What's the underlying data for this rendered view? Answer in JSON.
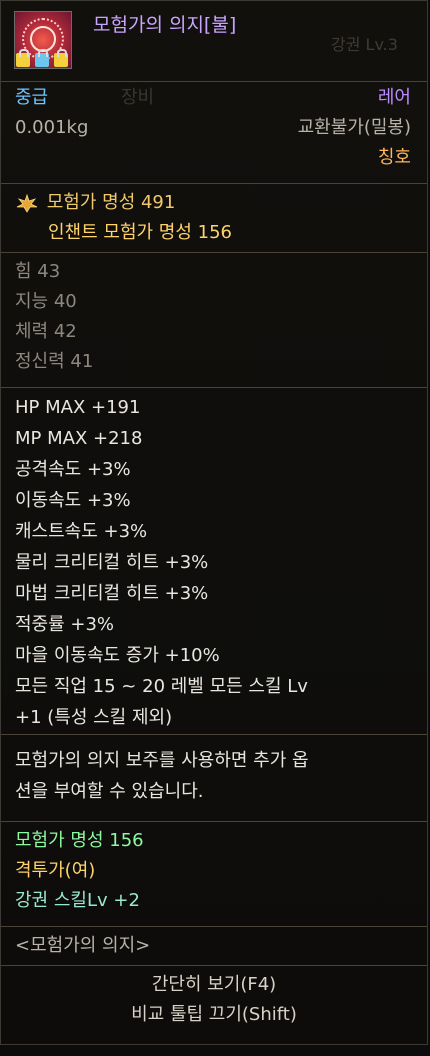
{
  "item": {
    "name": "모험가의 의지[불]",
    "watermark": "강권 Lv.3",
    "icon": "red-orb-emblem-icon",
    "lock_icons": [
      "yellow-lock-icon",
      "blue-lock-icon",
      "sync-icon"
    ]
  },
  "meta": {
    "grade_label": "중급",
    "weight": "0.001kg",
    "rarity": "레어",
    "trade": "교환불가(밀봉)",
    "type": "칭호",
    "bg_text": "장비"
  },
  "fame": {
    "label": "모험가 명성 491",
    "enchant": "인챈트 모험가 명성 156",
    "icon": "fame-crest-icon"
  },
  "base_stats": [
    "힘 43",
    "지능 40",
    "체력 42",
    "정신력 41"
  ],
  "options": [
    "HP MAX  +191",
    "MP MAX  +218",
    "공격속도  +3%",
    "이동속도  +3%",
    "캐스트속도  +3%",
    "물리 크리티컬 히트  +3%",
    "마법 크리티컬 히트  +3%",
    "적중률  +3%",
    "마을 이동속도 증가  +10%",
    "모든 직업 15 ~ 20 레벨 모든 스킬 Lv",
    "+1 (특성 스킬 제외)"
  ],
  "description": "모험가의 의지 보주를 사용하면 추가 옵션을 부여할 수 있습니다.",
  "description_lines": [
    "모험가의 의지 보주를 사용하면 추가 옵",
    "션을 부여할 수 있습니다."
  ],
  "enchant": {
    "line1": "모험가 명성 156",
    "line2": "격투가(여)",
    "line3": "강권 스킬Lv +2"
  },
  "set_name": "<모험가의 의지>",
  "footer": {
    "simple_view": "간단히 보기(F4)",
    "compare": "비교 툴팁 끄기(Shift)"
  },
  "colors": {
    "title": "#c9a4ff",
    "grade": "#6fc5ff",
    "rarity": "#bb8bff",
    "type": "#ffb65a",
    "fame": "#f0c96a",
    "enchant": "#8dfa9f"
  }
}
